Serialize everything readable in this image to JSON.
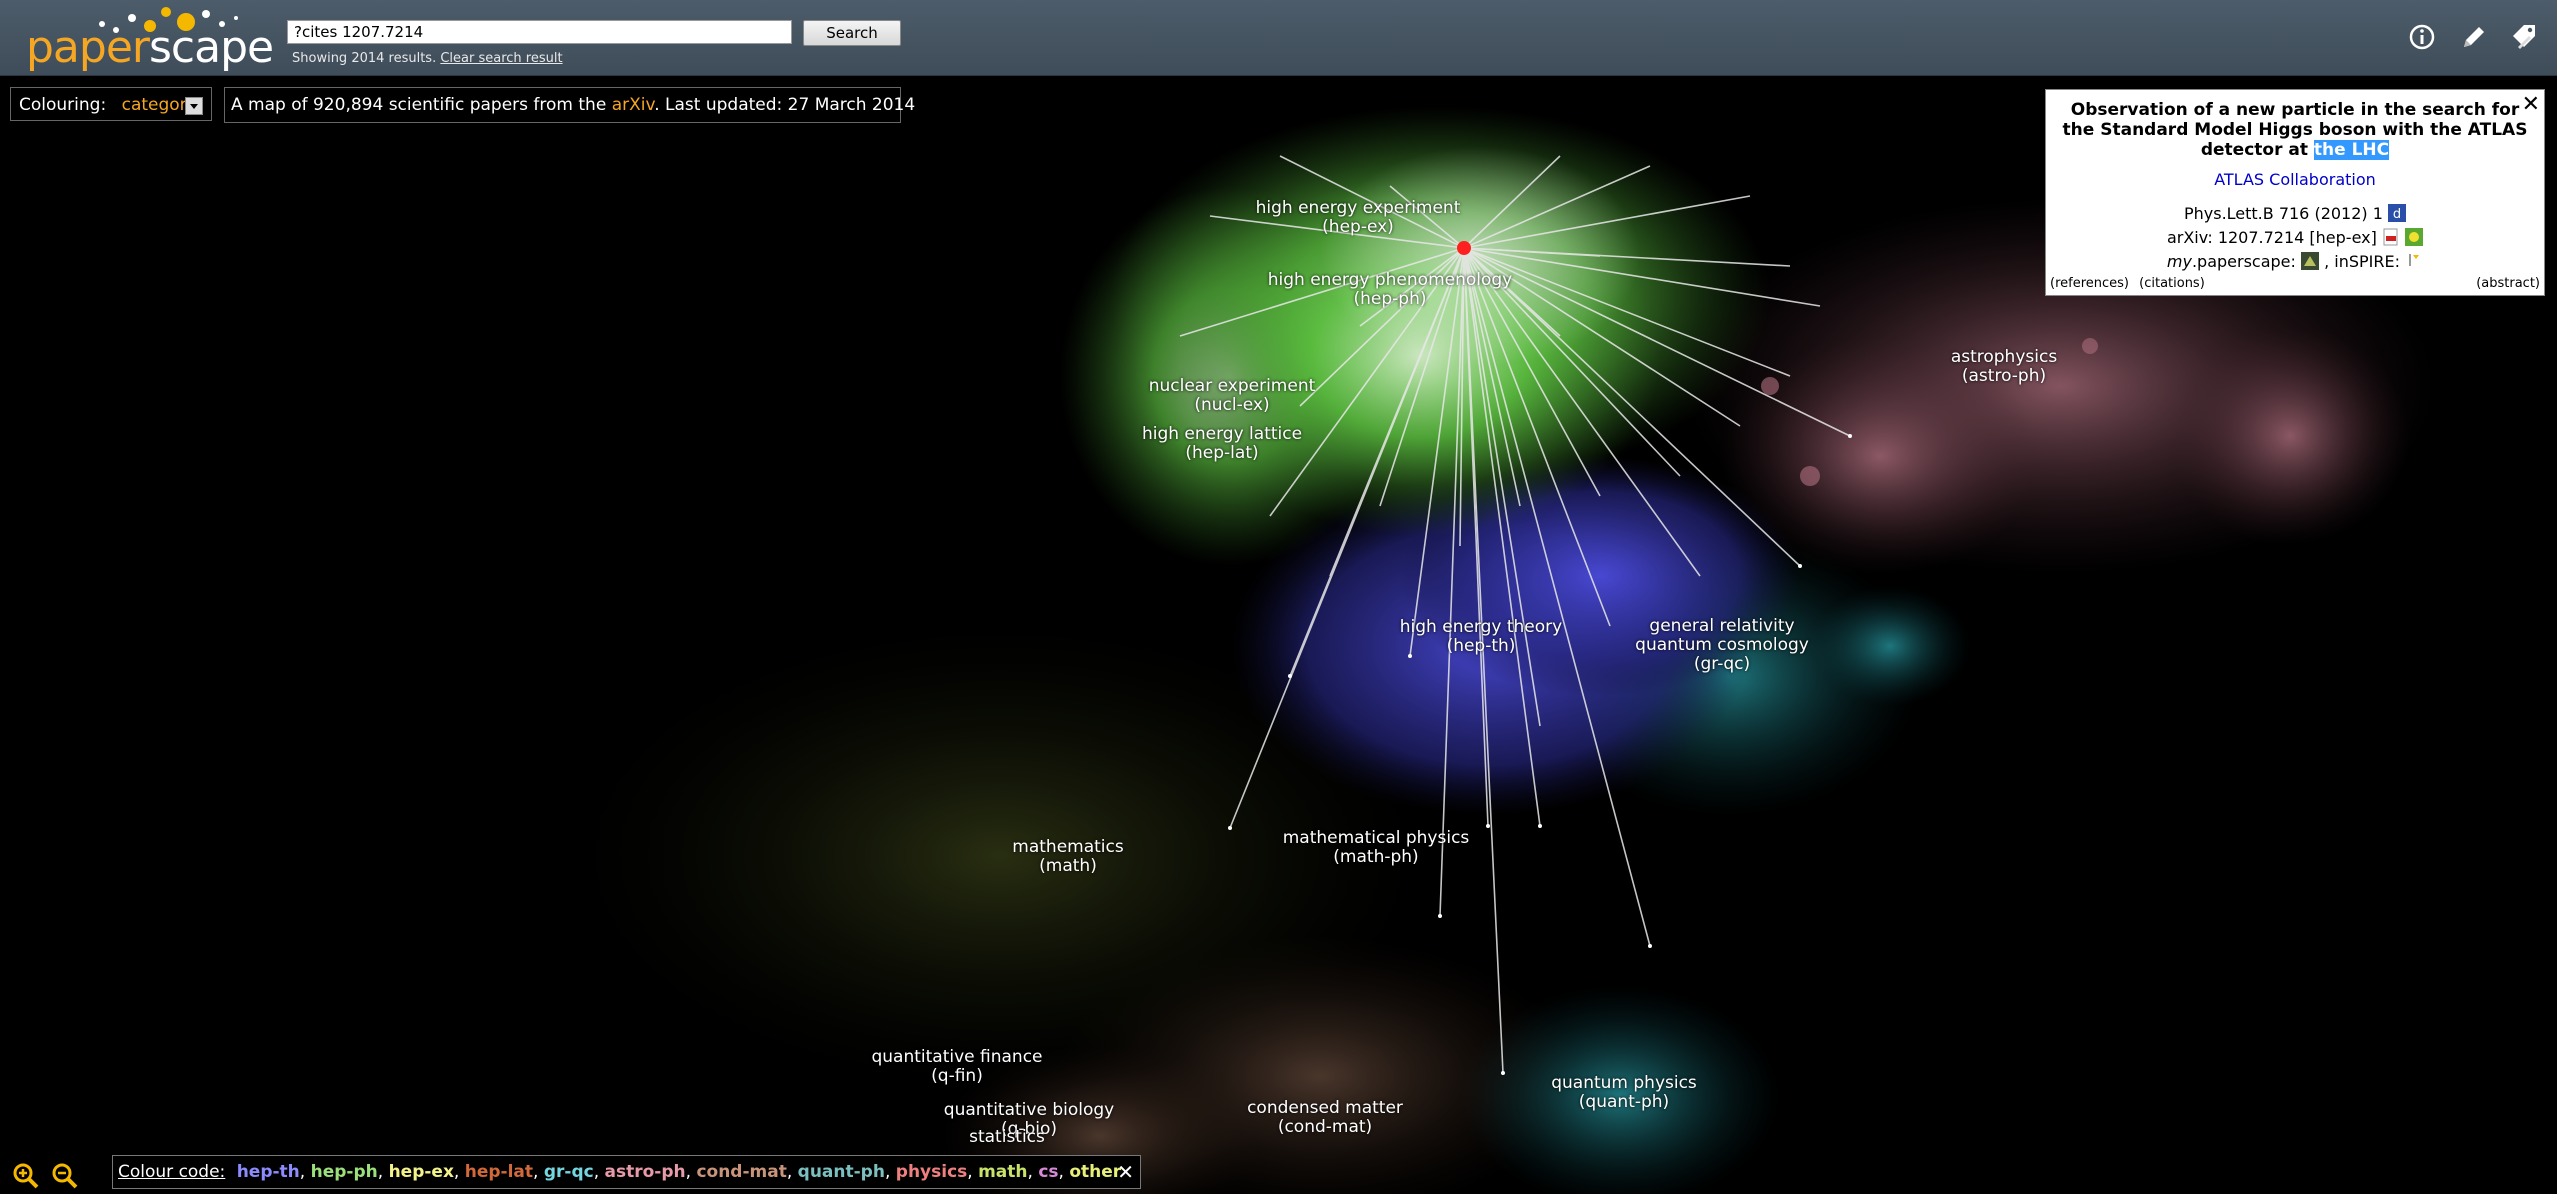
{
  "header": {
    "logo_part1": "paper",
    "logo_part2": "scape",
    "search_value": "?cites 1207.7214",
    "search_button": "Search",
    "results_text": "Showing 2014 results.",
    "clear_link": "Clear search result",
    "icons": [
      "info-icon",
      "pencil-icon",
      "tags-icon"
    ]
  },
  "toolbar": {
    "colouring_label": "Colouring:",
    "colouring_value": "category",
    "banner_prefix": "A map of 920,894 scientific papers from the ",
    "banner_arxiv": "arXiv",
    "banner_suffix": ". Last updated: 27 March 2014"
  },
  "paper": {
    "title_main": "Observation of a new particle in the search for the Standard Model Higgs boson with the ATLAS detector at ",
    "title_highlight": "the LHC",
    "authors": "ATLAS Collaboration",
    "journal": "Phys.Lett.B 716 (2012) 1",
    "arxiv": "arXiv: 1207.7214 [hep-ex]",
    "my_prefix": "my",
    "my_suffix": ".paperscape:",
    "inspire": ", inSPIRE:",
    "references": "(references)",
    "citations": "(citations)",
    "abstract": "(abstract)",
    "close": "✕"
  },
  "regions": [
    {
      "key": "hep_ex",
      "line1": "high energy experiment",
      "line2": "(hep-ex)"
    },
    {
      "key": "hep_ph",
      "line1": "high energy phenomenology",
      "line2": "(hep-ph)"
    },
    {
      "key": "nucl_ex",
      "line1": "nuclear experiment",
      "line2": "(nucl-ex)"
    },
    {
      "key": "hep_lat",
      "line1": "high energy lattice",
      "line2": "(hep-lat)"
    },
    {
      "key": "astro_ph",
      "line1": "astrophysics",
      "line2": "(astro-ph)"
    },
    {
      "key": "hep_th",
      "line1": "high energy theory",
      "line2": "(hep-th)"
    },
    {
      "key": "gr_qc",
      "line1": "general relativity",
      "line2": "quantum cosmology",
      "line3": "(gr-qc)"
    },
    {
      "key": "math",
      "line1": "mathematics",
      "line2": "(math)"
    },
    {
      "key": "math_ph",
      "line1": "mathematical physics",
      "line2": "(math-ph)"
    },
    {
      "key": "q_fin",
      "line1": "quantitative finance",
      "line2": "(q-fin)"
    },
    {
      "key": "q_bio",
      "line1": "quantitative biology",
      "line2": "(q-bio)"
    },
    {
      "key": "stat",
      "line1": "statistics"
    },
    {
      "key": "cond_mat",
      "line1": "condensed matter",
      "line2": "(cond-mat)"
    },
    {
      "key": "quant_ph",
      "line1": "quantum physics",
      "line2": "(quant-ph)"
    }
  ],
  "legend": {
    "label": "Colour code:",
    "items": [
      {
        "name": "hep-th",
        "color": "#8c8cff"
      },
      {
        "name": "hep-ph",
        "color": "#9be07a"
      },
      {
        "name": "hep-ex",
        "color": "#f4f28a"
      },
      {
        "name": "hep-lat",
        "color": "#d2693a"
      },
      {
        "name": "gr-qc",
        "color": "#74d6de"
      },
      {
        "name": "astro-ph",
        "color": "#e79aa8"
      },
      {
        "name": "cond-mat",
        "color": "#c9957a"
      },
      {
        "name": "quant-ph",
        "color": "#7bbfc0"
      },
      {
        "name": "physics",
        "color": "#f08080"
      },
      {
        "name": "math",
        "color": "#c8e36a"
      },
      {
        "name": "cs",
        "color": "#d88ad8"
      },
      {
        "name": "other",
        "color": "#e8f07a"
      }
    ],
    "close": "✕"
  },
  "colors": {
    "header_bg": "#46545f",
    "accent": "#f5a623",
    "selected_paper": "#ff2020"
  }
}
